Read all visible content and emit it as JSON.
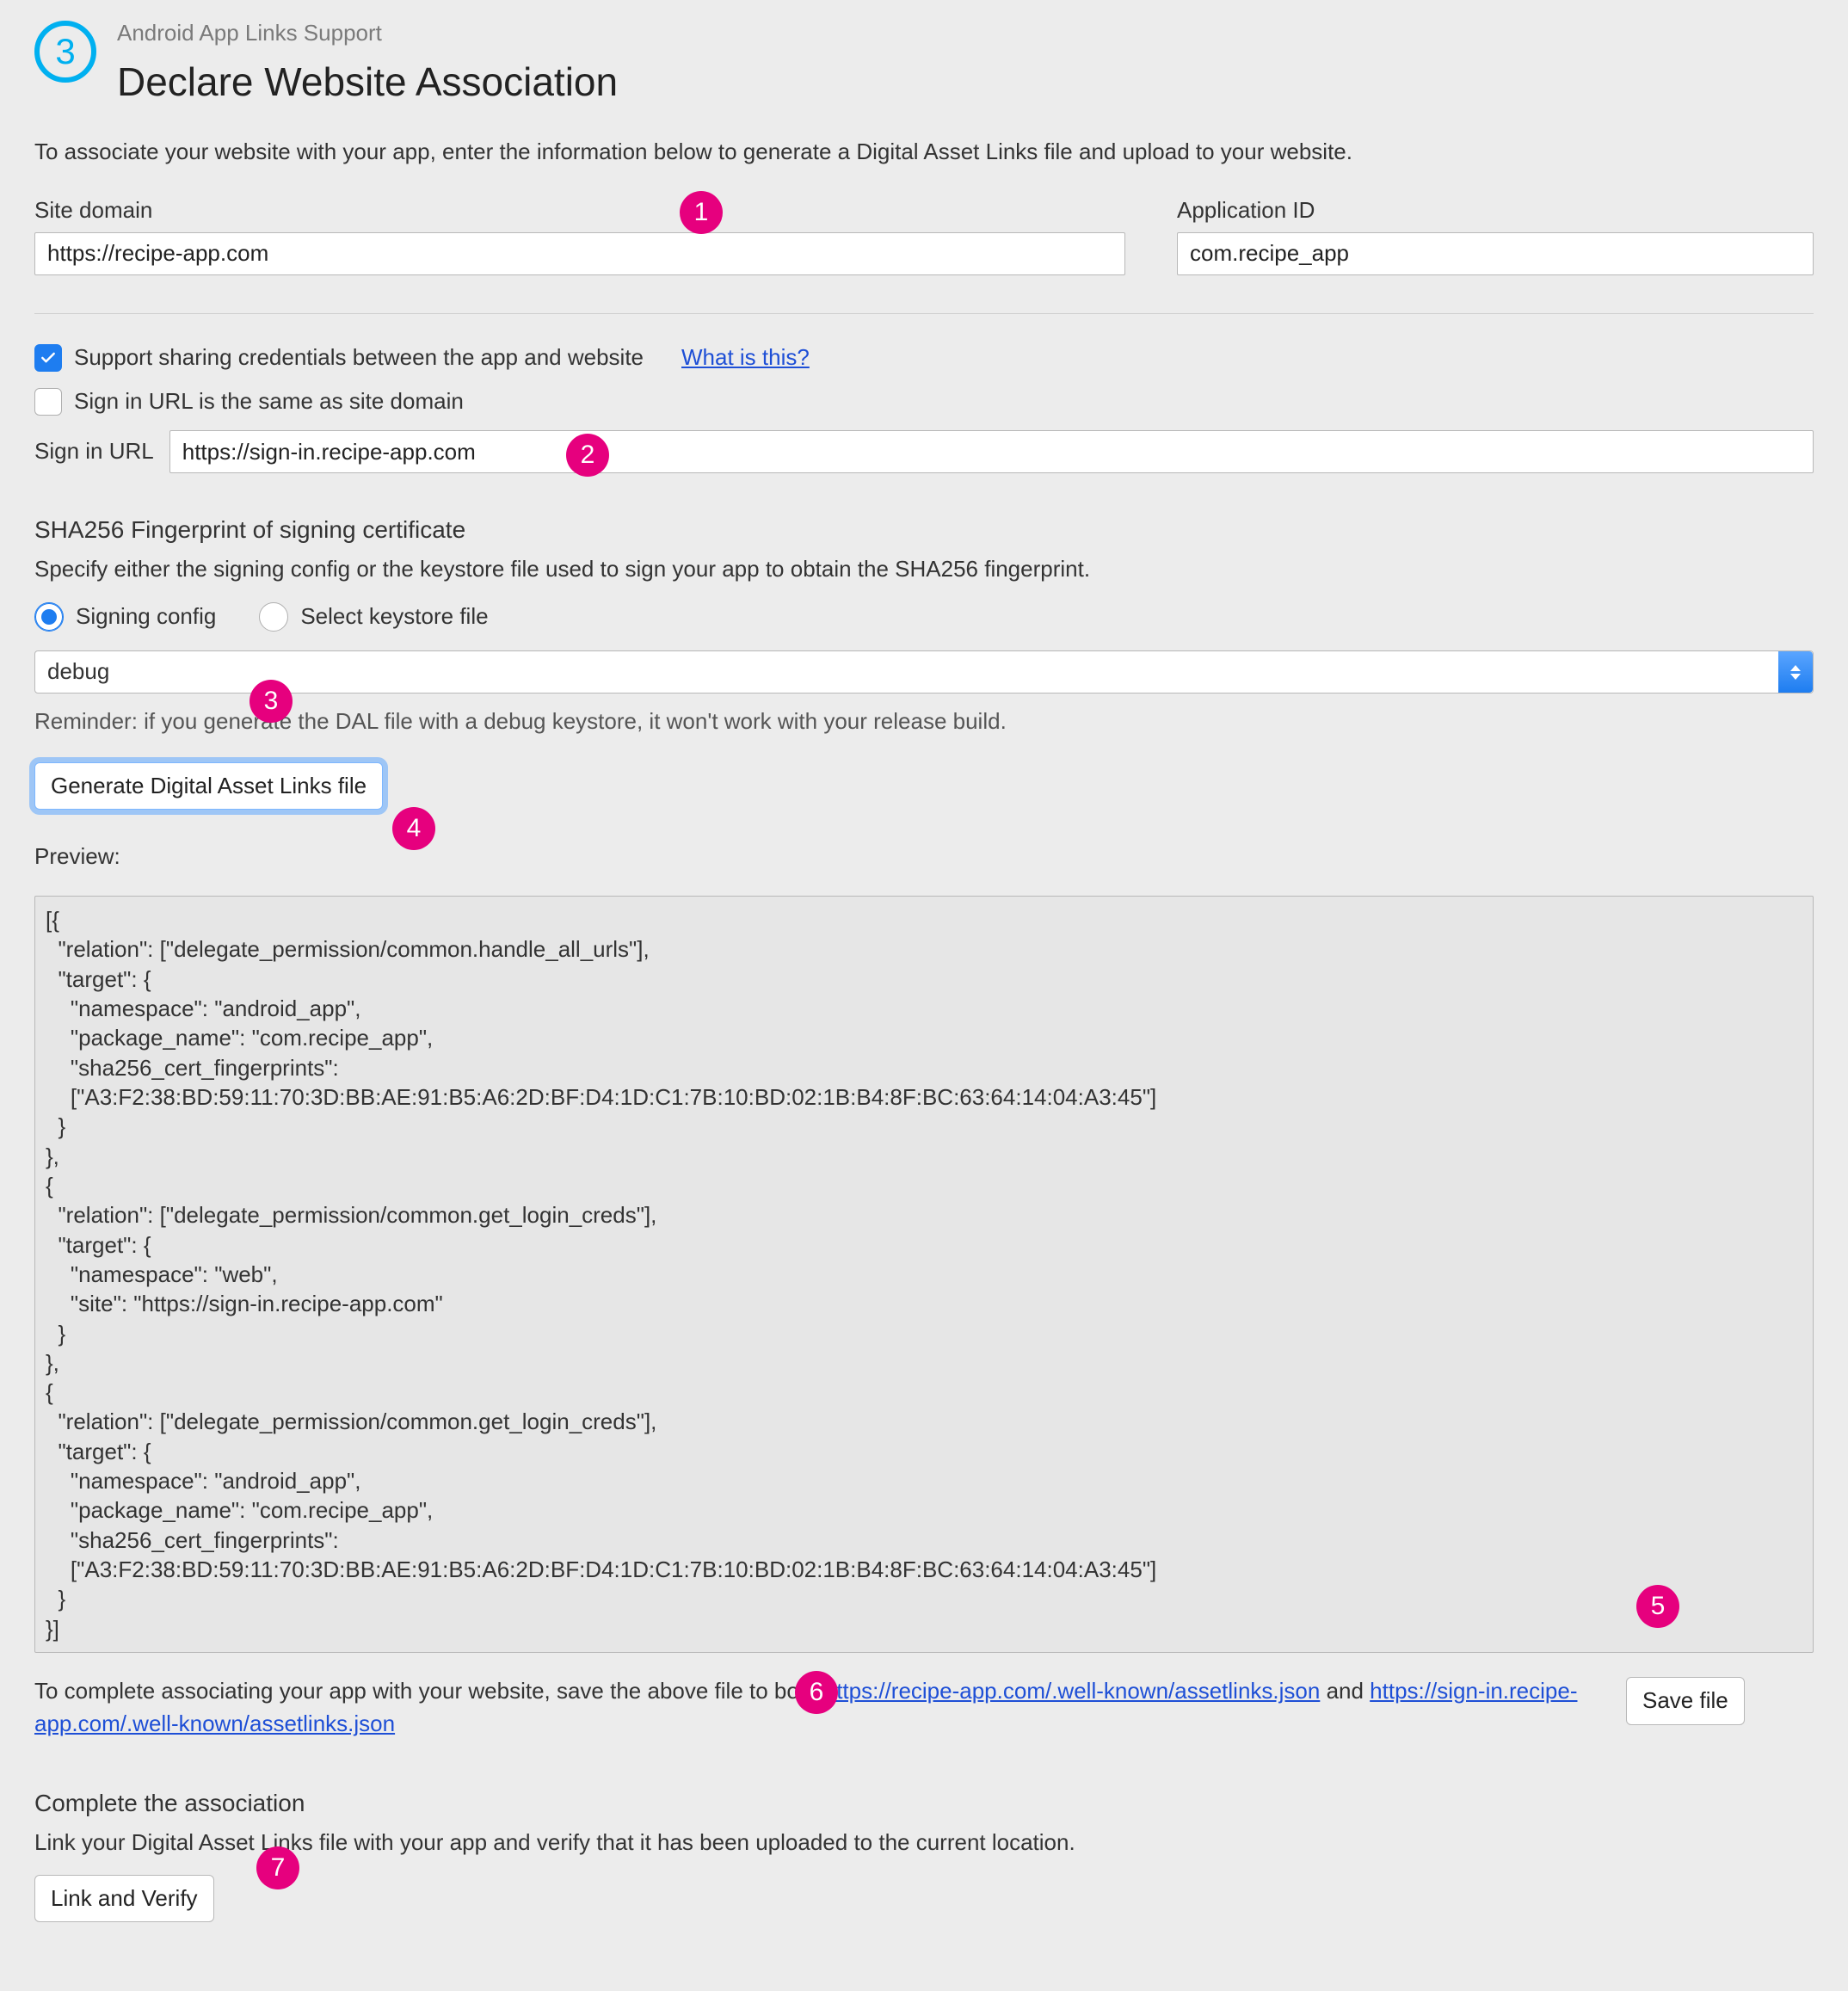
{
  "header": {
    "step": "3",
    "eyebrow": "Android App Links Support",
    "title": "Declare Website Association"
  },
  "intro": "To associate your website with your app, enter the information below to generate a Digital Asset Links file and upload to your website.",
  "site_domain": {
    "label": "Site domain",
    "value": "https://recipe-app.com"
  },
  "application_id": {
    "label": "Application ID",
    "value": "com.recipe_app"
  },
  "credentials": {
    "support_label": "Support sharing credentials between the app and website",
    "support_checked": true,
    "what_is_this": "What is this?",
    "same_as_domain_label": "Sign in URL is the same as site domain",
    "same_as_domain_checked": false,
    "sign_in_url_label": "Sign in URL",
    "sign_in_url_value": "https://sign-in.recipe-app.com"
  },
  "sha": {
    "title": "SHA256 Fingerprint of signing certificate",
    "subtitle": "Specify either the signing config or the keystore file used to sign your app to obtain the SHA256 fingerprint.",
    "radio_signing": "Signing config",
    "radio_keystore": "Select keystore file",
    "selected": "signing",
    "select_value": "debug",
    "reminder": "Reminder: if you generate the DAL file with a debug keystore, it won't work with your release build."
  },
  "generate_button": "Generate Digital Asset Links file",
  "preview_label": "Preview:",
  "preview_text": "[{\n  \"relation\": [\"delegate_permission/common.handle_all_urls\"],\n  \"target\": {\n    \"namespace\": \"android_app\",\n    \"package_name\": \"com.recipe_app\",\n    \"sha256_cert_fingerprints\":\n    [\"A3:F2:38:BD:59:11:70:3D:BB:AE:91:B5:A6:2D:BF:D4:1D:C1:7B:10:BD:02:1B:B4:8F:BC:63:64:14:04:A3:45\"]\n  }\n},\n{\n  \"relation\": [\"delegate_permission/common.get_login_creds\"],\n  \"target\": {\n    \"namespace\": \"web\",\n    \"site\": \"https://sign-in.recipe-app.com\"\n  }\n},\n{\n  \"relation\": [\"delegate_permission/common.get_login_creds\"],\n  \"target\": {\n    \"namespace\": \"android_app\",\n    \"package_name\": \"com.recipe_app\",\n    \"sha256_cert_fingerprints\":\n    [\"A3:F2:38:BD:59:11:70:3D:BB:AE:91:B5:A6:2D:BF:D4:1D:C1:7B:10:BD:02:1B:B4:8F:BC:63:64:14:04:A3:45\"]\n  }\n}]",
  "save": {
    "prefix": "To complete associating your app with your website, save the above file to both ",
    "link1": "https://recipe-app.com/.well-known/assetlinks.json",
    "mid": " and ",
    "link2": "https://sign-in.recipe-app.com/.well-known/assetlinks.json",
    "button": "Save file"
  },
  "complete": {
    "title": "Complete the association",
    "text": "Link your Digital Asset Links file with your app and verify that it has been uploaded to the current location.",
    "button": "Link and Verify"
  },
  "badges": [
    "1",
    "2",
    "3",
    "4",
    "5",
    "6",
    "7"
  ]
}
